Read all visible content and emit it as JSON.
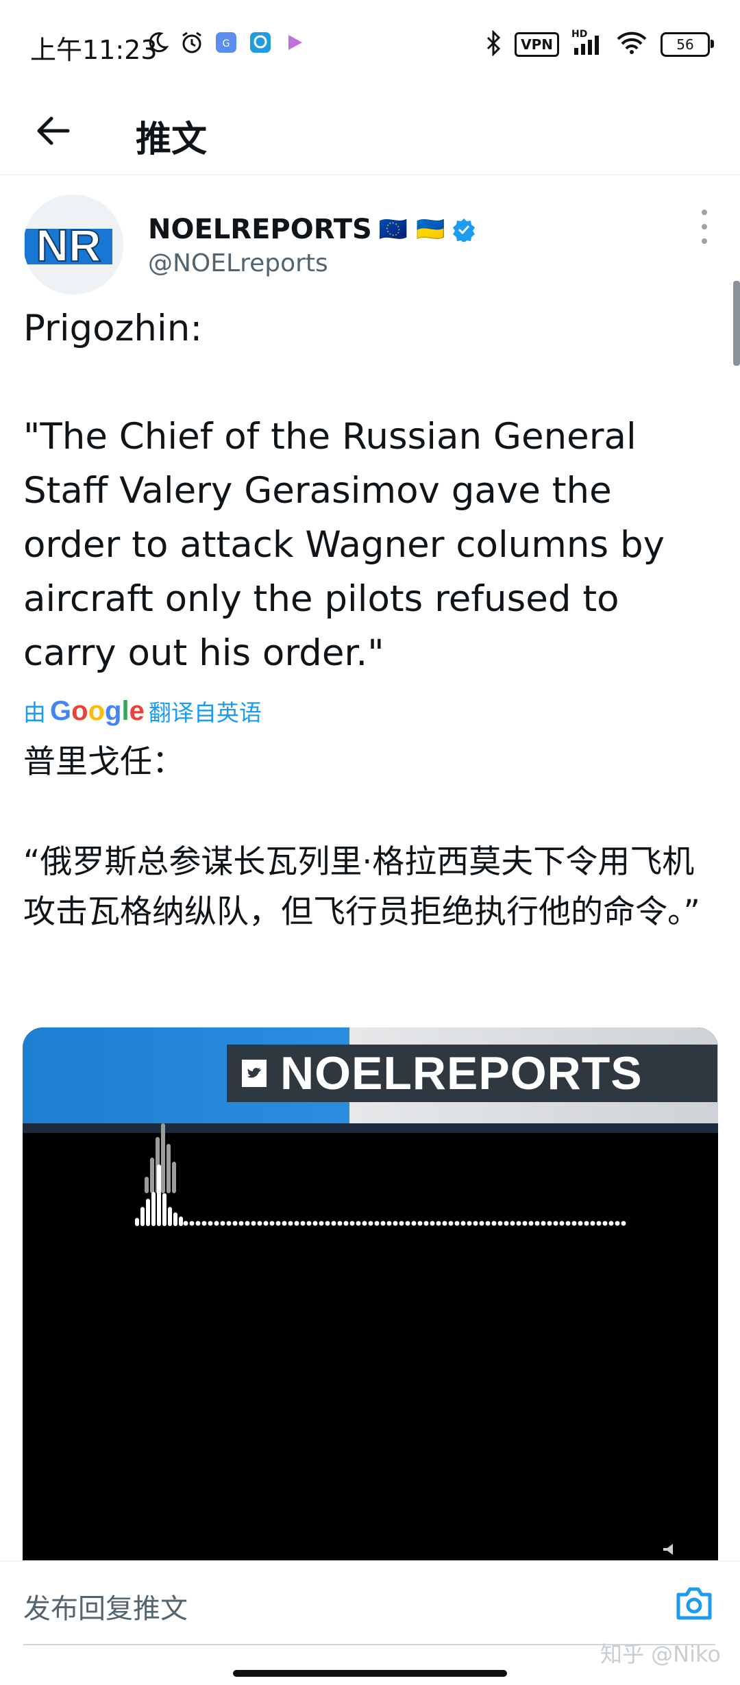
{
  "status_bar": {
    "time": "上午11:23",
    "vpn_label": "VPN",
    "network_label": "HD",
    "battery": "56"
  },
  "header": {
    "title": "推文"
  },
  "tweet": {
    "author_name": "NOELREPORTS",
    "author_flags": "🇪🇺 🇺🇦",
    "author_handle": "@NOELreports",
    "avatar_text": "NR",
    "text": "Prigozhin:\n\n\"The Chief of the Russian General Staff Valery Gerasimov gave the order to attack Wagner columns by aircraft only the pilots refused to carry out his order.\"",
    "translation_prefix": "由",
    "translation_provider": "Google",
    "translation_suffix": "翻译自英语",
    "translated_text": "普里戈任：\n\n“俄罗斯总参谋长瓦列里·格拉西莫夫下令用飞机攻击瓦格纳纵队，但飞行员拒绝执行他的命令。”",
    "media_brand": "NOELREPORTS"
  },
  "reply_bar": {
    "placeholder": "发布回复推文"
  },
  "watermark": "知乎 @Niko",
  "icons": {
    "back": "arrow-left-icon",
    "more": "more-vertical-icon",
    "verified": "verified-badge-icon",
    "camera": "camera-icon",
    "mute": "speaker-icon"
  },
  "colors": {
    "accent": "#1d9bf0",
    "text": "#0f1419",
    "secondary_text": "#536471"
  }
}
